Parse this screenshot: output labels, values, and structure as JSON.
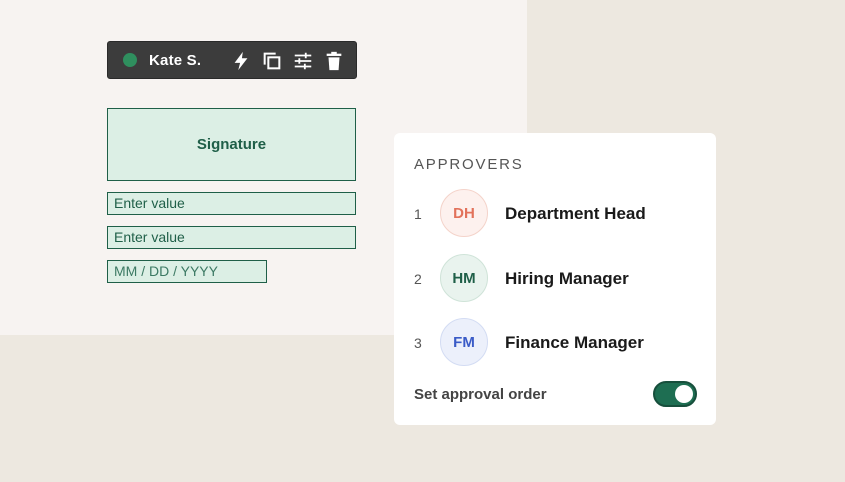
{
  "toolbar": {
    "user_name": "Kate S.",
    "user_color": "#2f8f5e",
    "icons": [
      "lightning-icon",
      "duplicate-icon",
      "settings-sliders-icon",
      "trash-icon"
    ]
  },
  "fields": {
    "signature_label": "Signature",
    "text_field_1": "Enter value",
    "text_field_2": "Enter value",
    "date_field": "MM / DD / YYYY"
  },
  "approvers": {
    "title": "APPROVERS",
    "items": [
      {
        "number": "1",
        "initials": "DH",
        "name": "Department Head",
        "color": "#e2725b"
      },
      {
        "number": "2",
        "initials": "HM",
        "name": "Hiring Manager",
        "color": "#1f5f48"
      },
      {
        "number": "3",
        "initials": "FM",
        "name": "Finance Manager",
        "color": "#3a5bc7"
      }
    ],
    "set_order_label": "Set approval order",
    "set_order_enabled": true
  }
}
